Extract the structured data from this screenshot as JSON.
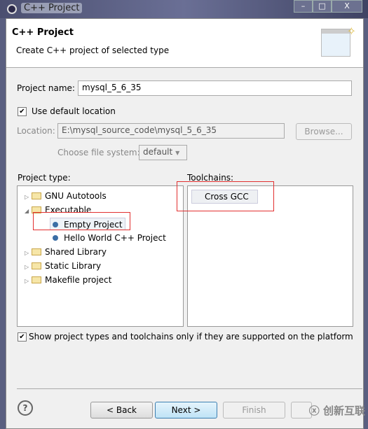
{
  "window": {
    "title": "C++ Project",
    "controls": [
      "–",
      "□",
      "X"
    ]
  },
  "header": {
    "title": "C++ Project",
    "subtitle": "Create C++ project of selected type"
  },
  "form": {
    "project_name_label": "Project name:",
    "project_name_value": "mysql_5_6_35",
    "use_default_location_label": "Use default location",
    "use_default_location_checked": true,
    "location_label": "Location:",
    "location_value": "E:\\mysql_source_code\\mysql_5_6_35",
    "browse_label": "Browse...",
    "file_system_label": "Choose file system:",
    "file_system_value": "default"
  },
  "project_type": {
    "label": "Project type:",
    "items": [
      {
        "label": "GNU Autotools",
        "kind": "folder",
        "expanded": false
      },
      {
        "label": "Executable",
        "kind": "folder",
        "expanded": true
      },
      {
        "label": "Empty Project",
        "kind": "leaf",
        "selected": true
      },
      {
        "label": "Hello World C++ Project",
        "kind": "leaf"
      },
      {
        "label": "Shared Library",
        "kind": "folder",
        "expanded": false
      },
      {
        "label": "Static Library",
        "kind": "folder",
        "expanded": false
      },
      {
        "label": "Makefile project",
        "kind": "folder",
        "expanded": false
      }
    ]
  },
  "toolchains": {
    "label": "Toolchains:",
    "items": [
      "Cross GCC"
    ]
  },
  "filter": {
    "label": "Show project types and toolchains only if they are supported on the platform",
    "checked": true
  },
  "buttons": {
    "back": "< Back",
    "next": "Next >",
    "finish": "Finish",
    "help": "?"
  },
  "watermark": "创新互联",
  "colors": {
    "highlight_box": "#e23030",
    "default_button": "#3c7fb1"
  }
}
